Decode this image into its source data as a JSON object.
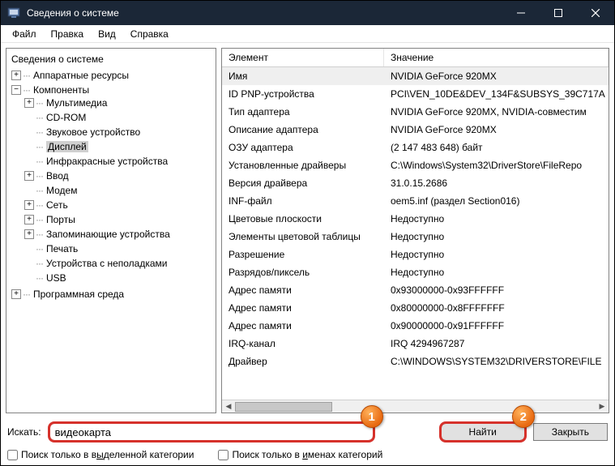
{
  "window": {
    "title": "Сведения о системе"
  },
  "menu": {
    "file": "Файл",
    "edit": "Правка",
    "view": "Вид",
    "help": "Справка"
  },
  "tree": {
    "root": "Сведения о системе",
    "hw": "Аппаратные ресурсы",
    "comp": "Компоненты",
    "mm": "Мультимедиа",
    "cdrom": "CD-ROM",
    "sound": "Звуковое устройство",
    "display": "Дисплей",
    "ir": "Инфракрасные устройства",
    "input": "Ввод",
    "modem": "Модем",
    "net": "Сеть",
    "ports": "Порты",
    "storage": "Запоминающие устройства",
    "print": "Печать",
    "problem": "Устройства с неполадками",
    "usb": "USB",
    "soft": "Программная среда"
  },
  "table": {
    "h1": "Элемент",
    "h2": "Значение",
    "rows": [
      {
        "k": "Имя",
        "v": "NVIDIA GeForce 920MX",
        "hl": true
      },
      {
        "k": "ID PNP-устройства",
        "v": "PCI\\VEN_10DE&DEV_134F&SUBSYS_39C717A"
      },
      {
        "k": "Тип адаптера",
        "v": "NVIDIA GeForce 920MX, NVIDIA-совместим"
      },
      {
        "k": "Описание адаптера",
        "v": "NVIDIA GeForce 920MX"
      },
      {
        "k": "ОЗУ адаптера",
        "v": "(2 147 483 648) байт"
      },
      {
        "k": "Установленные драйверы",
        "v": "C:\\Windows\\System32\\DriverStore\\FileRepo"
      },
      {
        "k": "Версия драйвера",
        "v": "31.0.15.2686"
      },
      {
        "k": "INF-файл",
        "v": "oem5.inf (раздел Section016)"
      },
      {
        "k": "Цветовые плоскости",
        "v": "Недоступно"
      },
      {
        "k": "Элементы цветовой таблицы",
        "v": "Недоступно"
      },
      {
        "k": "Разрешение",
        "v": "Недоступно"
      },
      {
        "k": "Разрядов/пиксель",
        "v": "Недоступно"
      },
      {
        "k": "Адрес памяти",
        "v": "0x93000000-0x93FFFFFF"
      },
      {
        "k": "Адрес памяти",
        "v": "0x80000000-0x8FFFFFFF"
      },
      {
        "k": "Адрес памяти",
        "v": "0x90000000-0x91FFFFFF"
      },
      {
        "k": "IRQ-канал",
        "v": "IRQ 4294967287"
      },
      {
        "k": "Драйвер",
        "v": "C:\\WINDOWS\\SYSTEM32\\DRIVERSTORE\\FILE"
      }
    ]
  },
  "search": {
    "label": "Искать:",
    "value": "видеокарта",
    "find": "Найти",
    "close": "Закрыть"
  },
  "callouts": {
    "one": "1",
    "two": "2"
  },
  "checks": {
    "cat_prefix": "Поиск только в в",
    "cat_und": "ы",
    "cat_suffix": "деленной категории",
    "name_prefix": "Поиск только в ",
    "name_und": "и",
    "name_suffix": "менах категорий"
  }
}
